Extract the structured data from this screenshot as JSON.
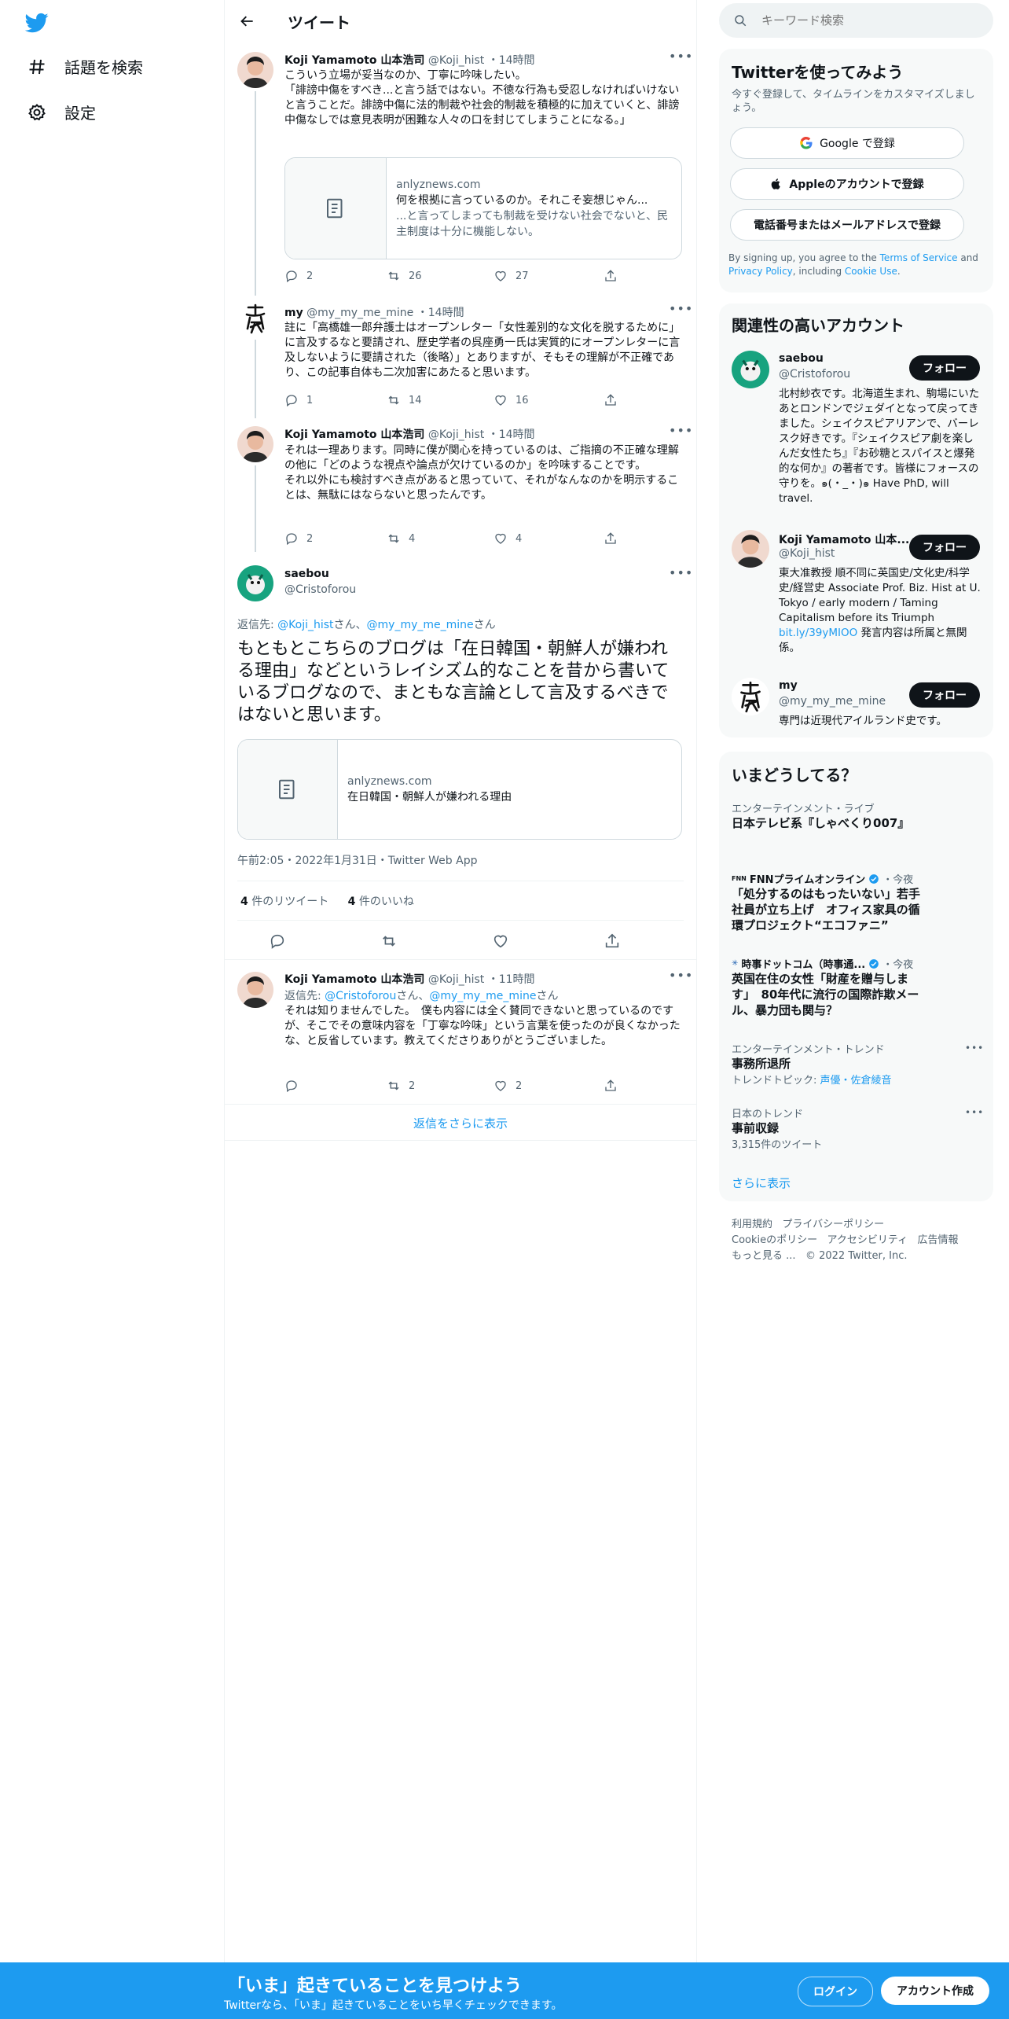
{
  "nav": {
    "items": [
      {
        "label": "話題を検索",
        "icon": "hashtag-icon"
      },
      {
        "label": "設定",
        "icon": "gear-icon"
      }
    ]
  },
  "header": {
    "title": "ツイート"
  },
  "tweets": [
    {
      "name": "Koji Yamamoto 山本浩司",
      "handle": "@Koji_hist",
      "time": "・14時間",
      "text": "こういう立場が妥当なのか、丁寧に吟味したい。\n「誹謗中傷をすべき...と言う話ではない。不徳な行為も受忍しなければいけないと言うことだ。誹謗中傷に法的制裁や社会的制裁を積極的に加えていくと、誹謗中傷なしでは意見表明が困難な人々の口を封じてしまうことになる。」",
      "card": {
        "domain": "anlyznews.com",
        "title": "何を根拠に言っているのか。それこそ妄想じゃん...",
        "desc": "...と言ってしまっても制裁を受けない社会でないと、民主制度は十分に機能しない。"
      },
      "replies": "2",
      "retweets": "26",
      "likes": "27"
    },
    {
      "name": "my",
      "handle": "@my_my_me_mine",
      "time": "・14時間",
      "text": "註に「高橋雄一郎弁護士はオープンレター「女性差別的な文化を脱するために」に言及するなと要請され、歴史学者の呉座勇一氏は実質的にオープンレターに言及しないように要請された（後略）」とありますが、そもその理解が不正確であり、この記事自体も二次加害にあたると思います。",
      "replies": "1",
      "retweets": "14",
      "likes": "16"
    },
    {
      "name": "Koji Yamamoto 山本浩司",
      "handle": "@Koji_hist",
      "time": "・14時間",
      "text": "それは一理あります。同時に僕が関心を持っているのは、ご指摘の不正確な理解の他に「どのような視点や論点が欠けているのか」を吟味することです。\nそれ以外にも検討すべき点があると思っていて、それがなんなのかを明示することは、無駄にはならないと思ったんです。",
      "replies": "2",
      "retweets": "4",
      "likes": "4"
    }
  ],
  "main_tweet": {
    "name": "saebou",
    "handle": "@Cristoforou",
    "reply_prefix": "返信先: ",
    "reply_user1": "@Koji_hist",
    "reply_mid": "さん、",
    "reply_user2": "@my_my_me_mine",
    "reply_suffix": "さん",
    "text": "もともとこちらのブログは「在日韓国・朝鮮人が嫌われる理由」などというレイシズム的なことを昔から書いているブログなので、まともな言論として言及するべきではないと思います。",
    "card": {
      "domain": "anlyznews.com",
      "title": "在日韓国・朝鮮人が嫌われる理由"
    },
    "meta": "午前2:05・2022年1月31日・Twitter Web App",
    "retweet_count": "4",
    "retweet_label": " 件のリツイート",
    "like_count": "4",
    "like_label": " 件のいいね"
  },
  "reply_tweet": {
    "name": "Koji Yamamoto 山本浩司",
    "handle": "@Koji_hist",
    "time": "・11時間",
    "reply_prefix": "返信先: ",
    "reply_user1": "@Cristoforou",
    "reply_mid": "さん、",
    "reply_user2": "@my_my_me_mine",
    "reply_suffix": "さん",
    "text": "それは知りませんでした。　僕も内容には全く賛同できないと思っているのですが、そこでその意味内容を「丁寧な吟味」という言葉を使ったのが良くなかったな、と反省しています。教えてくださりありがとうございました。",
    "retweets": "2",
    "likes": "2"
  },
  "show_more_replies": "返信をさらに表示",
  "search": {
    "placeholder": "キーワード検索"
  },
  "signup": {
    "title": "Twitterを使ってみよう",
    "subtitle": "今すぐ登録して、タイムラインをカスタマイズしましょう。",
    "google": "Google で登録",
    "apple": "Appleのアカウントで登録",
    "phone": "電話番号またはメールアドレスで登録",
    "terms_prefix": "By signing up, you agree to the ",
    "terms_link": "Terms of Service",
    "terms_and": " and ",
    "privacy_link": "Privacy Policy",
    "terms_inc": ", including ",
    "cookie_link": "Cookie Use",
    "terms_end": "."
  },
  "related": {
    "title": "関連性の高いアカウント",
    "follow_label": "フォロー",
    "accounts": [
      {
        "name": "saebou",
        "handle": "@Cristoforou",
        "bio": "北村紗衣です。北海道生まれ、駒場にいたあとロンドンでジェダイとなって戻ってきました。シェイクスピアリアンで、バーレスク好きです。『シェイクスピア劇を楽しんだ女性たち』『お砂糖とスパイスと爆発的な何か』の著者です。皆様にフォースの守りを。๑(・_・)๑ Have PhD, will travel."
      },
      {
        "name": "Koji Yamamoto 山本...",
        "handle": "@Koji_hist",
        "bio": "東大准教授 順不同に英国史/文化史/科学史/経営史 Associate Prof. Biz. Hist at U. Tokyo / early modern / Taming Capitalism before its Triumph ",
        "link": "bit.ly/39yMIOO",
        "bio2": " 発言内容は所属と無関係。"
      },
      {
        "name": "my",
        "handle": "@my_my_me_mine",
        "bio": "専門は近現代アイルランド史です。"
      }
    ]
  },
  "trends": {
    "title": "いまどうしてる？",
    "items": [
      {
        "category": "エンターテインメント・ライブ",
        "title": "日本テレビ系『しゃべくり007』"
      },
      {
        "source": "FNNプライムオンライン",
        "time": "・今夜",
        "title": "「処分するのはもったいない」若手社員が立ち上げ　オフィス家具の循環プロジェクト“エコファニ”"
      },
      {
        "source": "時事ドットコム（時事通...",
        "time": "・今夜",
        "title": "英国在住の女性「財産を贈与します」　80年代に流行の国際詐欺メール、暴力団も関与？"
      },
      {
        "category": "エンターテインメント・トレンド",
        "title": "事務所退所",
        "sub_prefix": "トレンドトピック: ",
        "sub_link": "声優・佐倉綾音"
      },
      {
        "category": "日本のトレンド",
        "title": "事前収録",
        "count": "3,315件のツイート"
      }
    ],
    "show_more": "さらに表示"
  },
  "footer": {
    "links": [
      "利用規約",
      "プライバシーポリシー",
      "Cookieのポリシー",
      "アクセシビリティ",
      "広告情報",
      "もっと見る ..."
    ],
    "copyright": "© 2022 Twitter, Inc."
  },
  "bottom_bar": {
    "title": "「いま」起きていることを見つけよう",
    "subtitle": "Twitterなら、「いま」起きていることをいち早くチェックできます。",
    "login": "ログイン",
    "signup": "アカウント作成"
  },
  "colors": {
    "accent": "#1d9bf0",
    "text": "#0f1419",
    "secondary": "#536471",
    "verified": "#1d9bf0"
  }
}
